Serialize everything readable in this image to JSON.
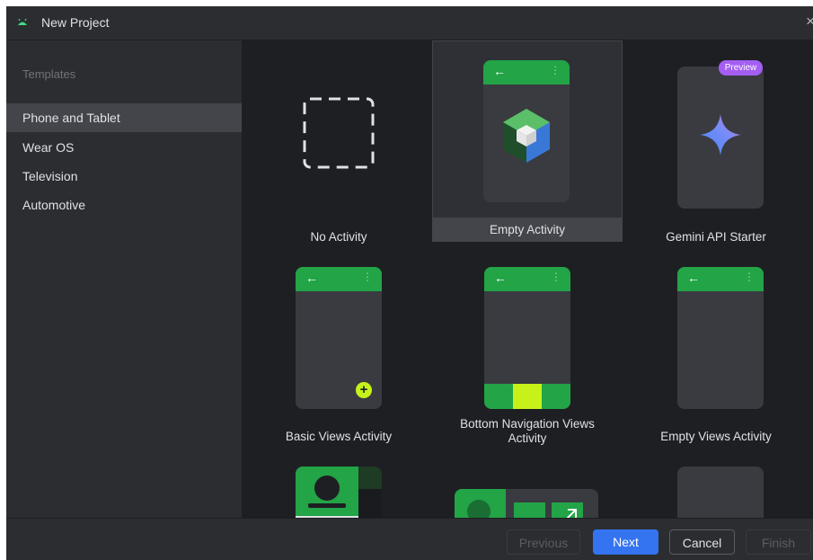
{
  "window": {
    "title": "New Project",
    "close_glyph": "×"
  },
  "sidebar": {
    "heading": "Templates",
    "items": [
      {
        "label": "Phone and Tablet",
        "selected": true
      },
      {
        "label": "Wear OS",
        "selected": false
      },
      {
        "label": "Television",
        "selected": false
      },
      {
        "label": "Automotive",
        "selected": false
      }
    ]
  },
  "templates": [
    {
      "label": "No Activity"
    },
    {
      "label": "Empty Activity",
      "selected": true
    },
    {
      "label": "Gemini API Starter",
      "badge": "Preview"
    },
    {
      "label": "Basic Views Activity"
    },
    {
      "label": "Bottom Navigation Views Activity"
    },
    {
      "label": "Empty Views Activity"
    }
  ],
  "glyphs": {
    "back_arrow": "←",
    "overflow_dots": "⋮",
    "plus": "+"
  },
  "footer": {
    "previous": "Previous",
    "next": "Next",
    "cancel": "Cancel",
    "finish": "Finish"
  },
  "colors": {
    "accent": "#3574f0",
    "android_green": "#22a447",
    "lime": "#c6f21a",
    "background": "#1e1f22",
    "panel": "#2b2d30"
  }
}
